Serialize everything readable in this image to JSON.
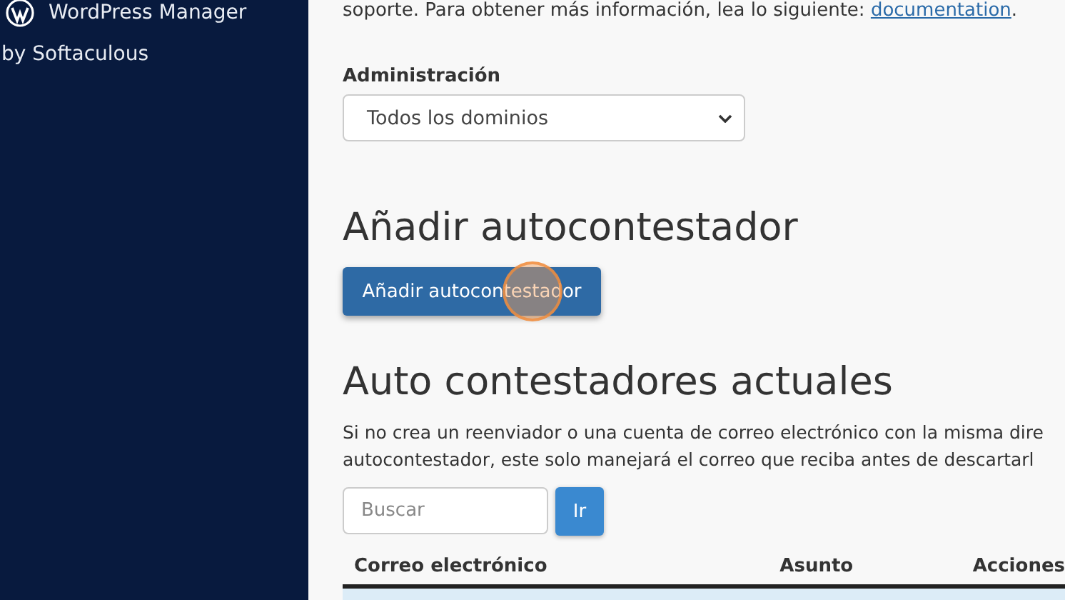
{
  "sidebar": {
    "items": [
      {
        "title": "WordPress Manager",
        "subtitle": "by Softaculous"
      }
    ]
  },
  "intro": {
    "text": "soporte. Para obtener más información, lea lo siguiente: ",
    "link": "documentation",
    "after": "."
  },
  "domain_filter": {
    "label": "Administración",
    "value": "Todos los dominios"
  },
  "add_section": {
    "heading": "Añadir autocontestador",
    "button": "Añadir autocontestador"
  },
  "current_section": {
    "heading": "Auto contestadores actuales",
    "lines": [
      "Si no crea un reenviador o una cuenta de correo electrónico con la misma dire",
      "autocontestador, este solo manejará el correo que reciba antes de descartarl"
    ],
    "search": {
      "placeholder": "Buscar",
      "button": "Ir"
    },
    "table": {
      "columns": [
        "Correo electrónico",
        "Asunto",
        "Acciones"
      ]
    }
  }
}
